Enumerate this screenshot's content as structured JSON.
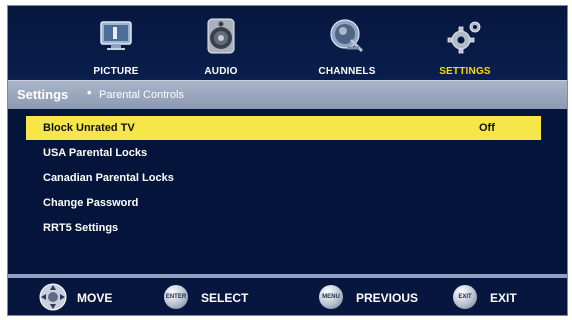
{
  "tabs": [
    {
      "label": "PICTURE",
      "icon": "picture-icon",
      "active": false
    },
    {
      "label": "AUDIO",
      "icon": "speaker-icon",
      "active": false
    },
    {
      "label": "CHANNELS",
      "icon": "satellite-dish-icon",
      "active": false
    },
    {
      "label": "SETTINGS",
      "icon": "gear-icon",
      "active": true
    }
  ],
  "breadcrumb": {
    "section": "Settings",
    "separator": "•",
    "page": "Parental Controls"
  },
  "menu": {
    "items": [
      {
        "label": "Block Unrated TV",
        "value": "Off",
        "selected": true
      },
      {
        "label": "USA Parental Locks",
        "value": "",
        "selected": false
      },
      {
        "label": "Canadian Parental Locks",
        "value": "",
        "selected": false
      },
      {
        "label": "Change Password",
        "value": "",
        "selected": false
      },
      {
        "label": "RRT5 Settings",
        "value": "",
        "selected": false
      }
    ]
  },
  "footer": {
    "move": {
      "label": "MOVE",
      "icon": "dpad-icon"
    },
    "select": {
      "label": "SELECT",
      "key": "ENTER"
    },
    "previous": {
      "label": "PREVIOUS",
      "key": "MENU"
    },
    "exit": {
      "label": "EXIT",
      "key": "EXIT"
    }
  },
  "colors": {
    "background": "#05143a",
    "highlight": "#f7e64a",
    "active_tab_text": "#f5d90a",
    "breadcrumb_bar": "#9aa6bd"
  }
}
